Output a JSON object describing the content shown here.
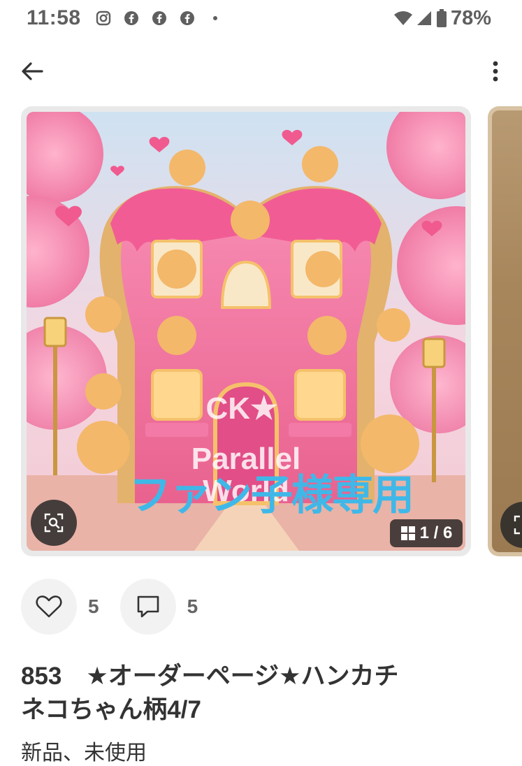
{
  "status_bar": {
    "time": "11:58",
    "battery_percent": "78%",
    "left_icons": [
      "instagram-icon",
      "facebook-icon",
      "facebook-icon",
      "facebook-icon",
      "dot-icon"
    ],
    "right_icons": [
      "wifi-icon",
      "signal-icon",
      "battery-icon"
    ]
  },
  "app_bar": {
    "back_icon": "arrow-left-icon",
    "more_icon": "more-vertical-icon"
  },
  "gallery": {
    "watermark_line1": "CK★",
    "watermark_line2": "Parallel",
    "watermark_line3": "World",
    "overlay_text": "ファン子様専用",
    "page_indicator": "1 / 6",
    "accent_color": "#3fb8e8"
  },
  "actions": {
    "likes_count": "5",
    "comments_count": "5"
  },
  "item": {
    "title": "853　★オーダーページ★ハンカチ\nネコちゃん柄4/7",
    "condition": "新品、未使用"
  }
}
